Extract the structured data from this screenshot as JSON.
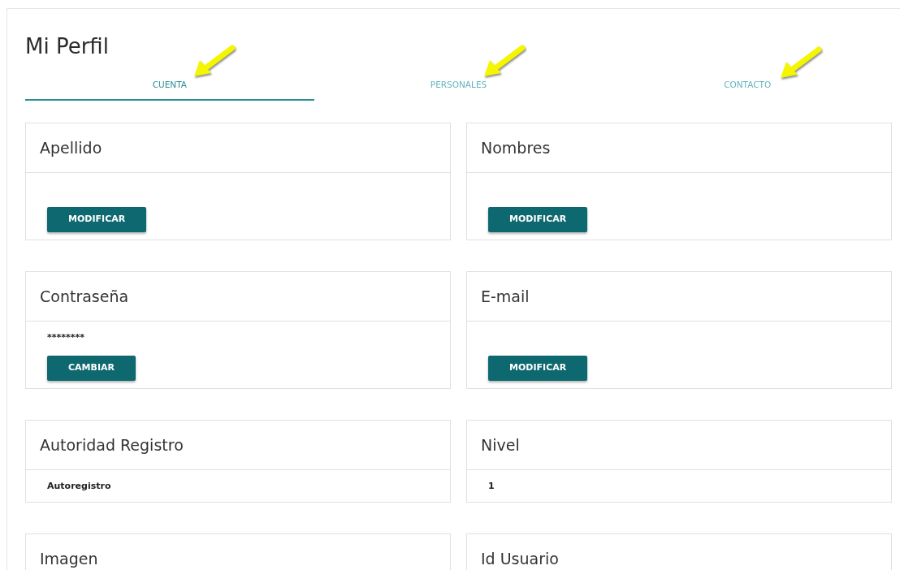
{
  "title": "Mi Perfil",
  "tabs": [
    {
      "label": "CUENTA",
      "selected": true
    },
    {
      "label": "PERSONALES",
      "selected": false
    },
    {
      "label": "CONTACTO",
      "selected": false
    }
  ],
  "cards": [
    {
      "title": "Apellido",
      "button": "MODIFICAR"
    },
    {
      "title": "Nombres",
      "button": "MODIFICAR"
    },
    {
      "title": "Contraseña",
      "value": "********",
      "button": "CAMBIAR"
    },
    {
      "title": "E-mail",
      "button": "MODIFICAR"
    },
    {
      "title": "Autoridad Registro",
      "value": "Autoregistro"
    },
    {
      "title": "Nivel",
      "value": "1"
    },
    {
      "title": "Imagen"
    },
    {
      "title": "Id Usuario"
    }
  ]
}
